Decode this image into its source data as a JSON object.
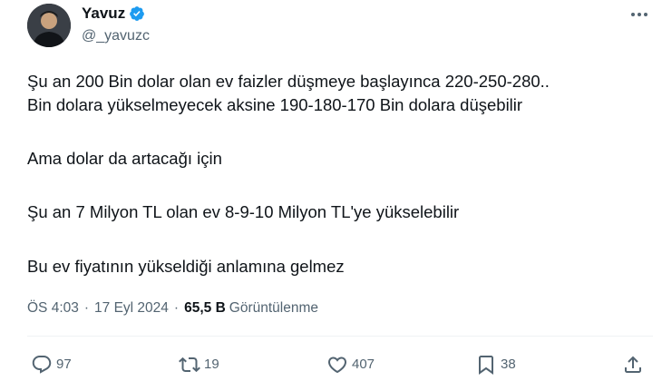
{
  "user": {
    "display_name": "Yavuz",
    "handle": "@_yavuzc",
    "verified": true,
    "verified_color": "#1d9bf0"
  },
  "post": {
    "lines": [
      "Şu an 200 Bin dolar olan ev faizler düşmeye başlayınca 220-250-280..",
      "Bin dolara yükselmeyecek aksine 190-180-170 Bin dolara düşebilir",
      "Ama dolar da artacağı için",
      "Şu an 7 Milyon TL olan ev 8-9-10 Milyon TL'ye yükselebilir",
      "Bu ev fiyatının yükseldiği anlamına gelmez"
    ]
  },
  "meta": {
    "time": "ÖS 4:03",
    "separator": "·",
    "date": "17 Eyl 2024",
    "views_count": "65,5 B",
    "views_label": "Görüntülenme"
  },
  "actions": {
    "replies": {
      "icon": "reply-icon",
      "count": "97"
    },
    "reposts": {
      "icon": "repost-icon",
      "count": "19"
    },
    "likes": {
      "icon": "heart-icon",
      "count": "407"
    },
    "bookmarks": {
      "icon": "bookmark-icon",
      "count": "38"
    },
    "share": {
      "icon": "share-icon"
    }
  },
  "header": {
    "more_icon": "more-options-icon"
  }
}
